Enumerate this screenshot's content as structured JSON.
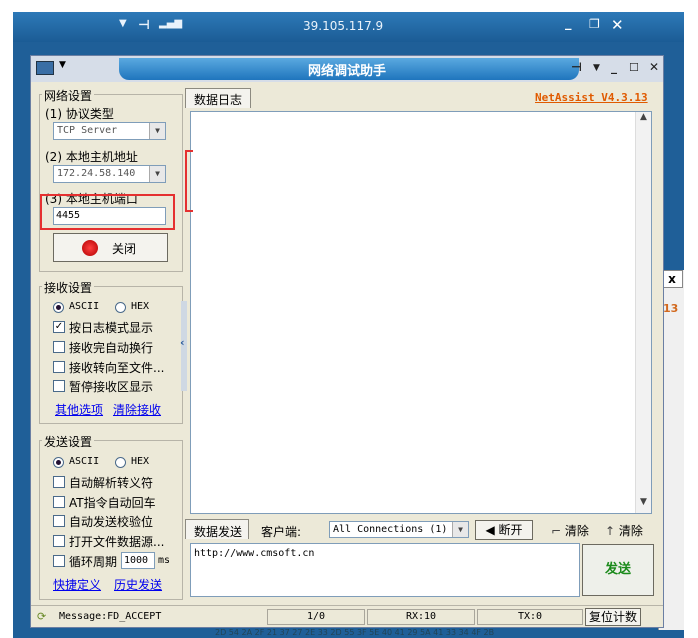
{
  "remote": {
    "address": "39.105.117.9",
    "min": "_",
    "max": "❐",
    "close": "✕"
  },
  "app": {
    "title": "网络调试助手",
    "version": "NetAssist V4.3.13"
  },
  "network": {
    "group": "网络设置",
    "protocol_label": "(1) 协议类型",
    "protocol_value": "TCP Server",
    "host_label": "(2) 本地主机地址",
    "host_value": "172.24.58.140",
    "port_label": "(3) 本地主机端口",
    "port_value": "4455",
    "close_btn": "关闭"
  },
  "receive": {
    "group": "接收设置",
    "ascii": "ASCII",
    "hex": "HEX",
    "log_mode": "按日志模式显示",
    "auto_wrap": "接收完自动换行",
    "to_file": "接收转向至文件...",
    "pause": "暂停接收区显示",
    "more": "其他选项",
    "clear": "清除接收"
  },
  "send": {
    "group": "发送设置",
    "ascii": "ASCII",
    "hex": "HEX",
    "escape": "自动解析转义符",
    "at_cr": "AT指令自动回车",
    "checksum": "自动发送校验位",
    "file_src": "打开文件数据源...",
    "cycle": "循环周期",
    "cycle_value": "1000",
    "cycle_unit": "ms",
    "shortcut": "快捷定义",
    "history": "历史发送"
  },
  "log": {
    "tab": "数据日志"
  },
  "send_bar": {
    "tab": "数据发送",
    "client_label": "客户端:",
    "client_value": "All Connections (1)",
    "disconnect": "断开",
    "clear1": "清除",
    "clear2": "清除",
    "content": "http://www.cmsoft.cn",
    "send_btn": "发送"
  },
  "status": {
    "message": "Message:FD_ACCEPT",
    "count": "1/0",
    "rx": "RX:10",
    "tx": "TX:0",
    "reset": "复位计数"
  },
  "background": {
    "num": "13",
    "close": "x",
    "bottom_text": "2D 54 2A 2F 21 37 27 2E 33 2D 55 3F 5E 40 41 29 5A 41 33 34 4F 2B"
  },
  "colors": {
    "rd_bar": "#1f5f98",
    "title_tab": "#1f75bd",
    "version": "#e05a00",
    "send_green": "#1a8a1a",
    "highlight": "#e53030"
  }
}
